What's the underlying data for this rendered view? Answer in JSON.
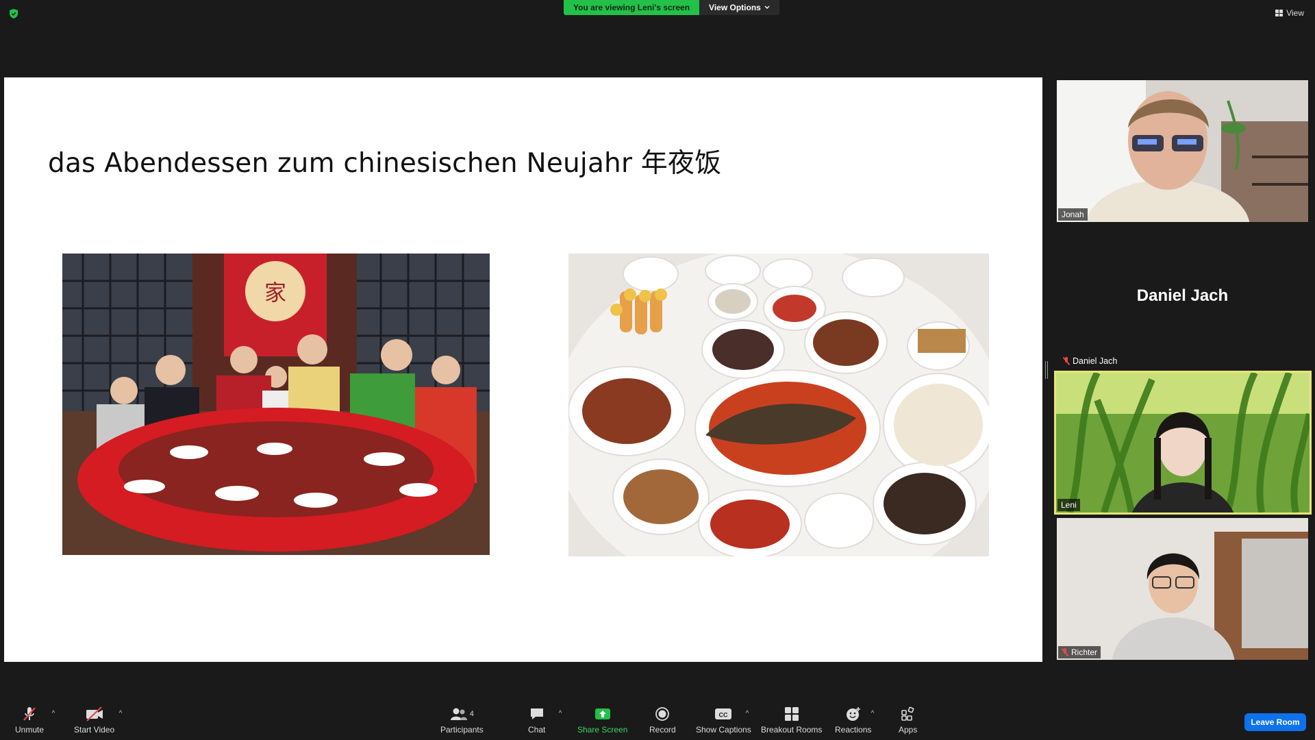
{
  "topbar": {
    "viewing_label": "You are viewing Leni's screen",
    "view_options_label": "View Options",
    "view_label": "View"
  },
  "slide": {
    "title": "das Abendessen zum chinesischen Neujahr  年夜饭"
  },
  "participants": {
    "jonah": "Jonah",
    "daniel_display": "Daniel Jach",
    "daniel_tag": "Daniel Jach",
    "leni": "Leni",
    "richter": "Richter"
  },
  "toolbar": {
    "unmute": "Unmute",
    "start_video": "Start Video",
    "participants_label": "Participants",
    "participants_count": "4",
    "chat": "Chat",
    "share_screen": "Share Screen",
    "record": "Record",
    "show_captions": "Show Captions",
    "breakout_rooms": "Breakout Rooms",
    "reactions": "Reactions",
    "apps": "Apps",
    "leave_room": "Leave Room",
    "cc_glyph": "CC"
  },
  "colors": {
    "accent_green": "#23c04a",
    "leave_blue": "#0e72ed",
    "active_speaker": "#e8e37a",
    "muted_red": "#e24a4a"
  },
  "icons": [
    "shield-icon",
    "chevron-down-icon",
    "grid-view-icon",
    "mic-off-icon",
    "video-off-icon",
    "participants-icon",
    "chat-icon",
    "share-screen-icon",
    "record-icon",
    "captions-icon",
    "breakout-rooms-icon",
    "reactions-icon",
    "apps-icon"
  ]
}
